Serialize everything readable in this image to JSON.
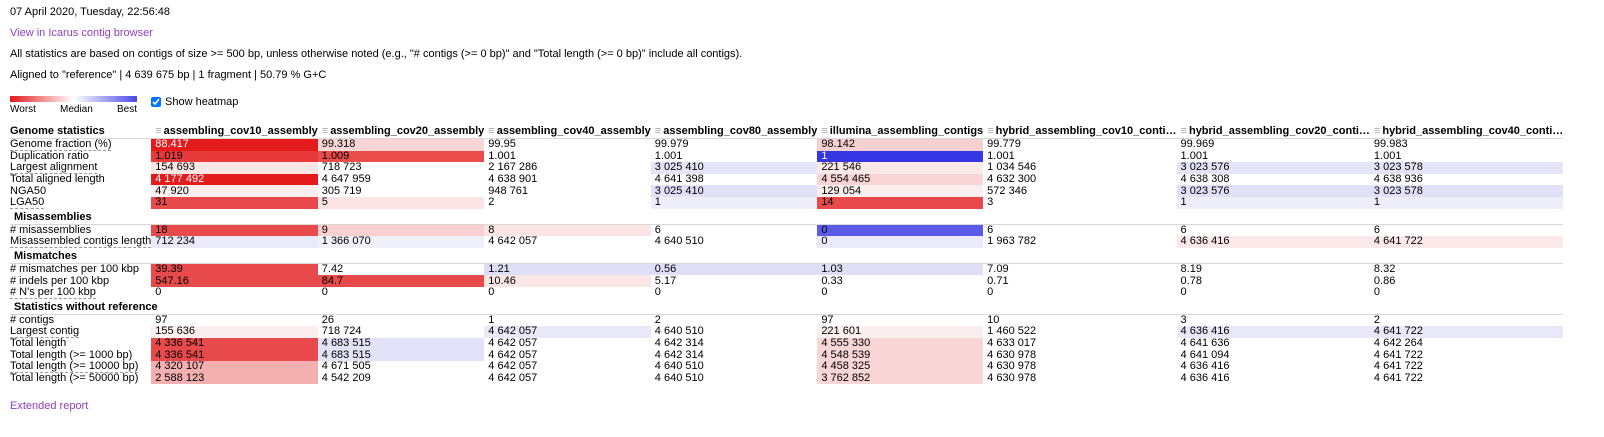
{
  "date": "07 April 2020, Tuesday, 22:56:48",
  "icarus_link": "View in Icarus contig browser",
  "note": "All statistics are based on contigs of size >= 500 bp, unless otherwise noted (e.g., \"# contigs (>= 0 bp)\" and \"Total length (>= 0 bp)\" include all contigs).",
  "reference": "Aligned to \"reference\" | 4 639 675 bp | 1 fragment | 50.79 % G+C",
  "heatmap": {
    "worst": "Worst",
    "median": "Median",
    "best": "Best",
    "show_label": "Show heatmap",
    "checked": true
  },
  "colors": {
    "worst": "#e41a1c",
    "best": "#4a4ae8",
    "link": "#9040c0"
  },
  "columns": [
    "assembling_cov10_assembly",
    "assembling_cov20_assembly",
    "assembling_cov40_assembly",
    "assembling_cov80_assembly",
    "illumina_assembling_contigs",
    "hybrid_assembling_cov10_conti…",
    "hybrid_assembling_cov20_conti…",
    "hybrid_assembling_cov40_conti…"
  ],
  "table": [
    {
      "title": "Genome statistics",
      "header": true,
      "rows": [
        {
          "name": "Genome fraction (%)",
          "cells": [
            {
              "v": "88.417",
              "bg": "#e31b1c",
              "fg": "#ffffff"
            },
            {
              "v": "99.318",
              "bg": "#f8d6d6"
            },
            {
              "v": "99.95",
              "bg": ""
            },
            {
              "v": "99.979",
              "bg": ""
            },
            {
              "v": "98.142",
              "bg": "#f6d0d0"
            },
            {
              "v": "99.779",
              "bg": ""
            },
            {
              "v": "99.969",
              "bg": ""
            },
            {
              "v": "99.983",
              "bg": ""
            }
          ]
        },
        {
          "name": "Duplication ratio",
          "cells": [
            {
              "v": "1.019",
              "bg": "#e8393a"
            },
            {
              "v": "1.009",
              "bg": "#eb4c4c"
            },
            {
              "v": "1.001",
              "bg": ""
            },
            {
              "v": "1.001",
              "bg": ""
            },
            {
              "v": "1",
              "bg": "#3636e4",
              "fg": "#ffffff"
            },
            {
              "v": "1.001",
              "bg": ""
            },
            {
              "v": "1.001",
              "bg": ""
            },
            {
              "v": "1.001",
              "bg": ""
            }
          ]
        },
        {
          "name": "Largest alignment",
          "cells": [
            {
              "v": "154 693",
              "bg": "#fbe6e6"
            },
            {
              "v": "718 723",
              "bg": ""
            },
            {
              "v": "2 167 286",
              "bg": ""
            },
            {
              "v": "3 025 410",
              "bg": "#e4e4f8"
            },
            {
              "v": "221 546",
              "bg": "#fbe8e8"
            },
            {
              "v": "1 034 546",
              "bg": ""
            },
            {
              "v": "3 023 576",
              "bg": "#e4e4f8"
            },
            {
              "v": "3 023 578",
              "bg": "#e4e4f8"
            }
          ]
        },
        {
          "name": "Total aligned length",
          "cells": [
            {
              "v": "4 177 492",
              "bg": "#e31b1c",
              "fg": "#ffffff"
            },
            {
              "v": "4 647 959",
              "bg": ""
            },
            {
              "v": "4 638 901",
              "bg": ""
            },
            {
              "v": "4 641 398",
              "bg": ""
            },
            {
              "v": "4 554 465",
              "bg": "#f8d4d4"
            },
            {
              "v": "4 632 300",
              "bg": ""
            },
            {
              "v": "4 638 308",
              "bg": ""
            },
            {
              "v": "4 638 936",
              "bg": ""
            }
          ]
        },
        {
          "name": "NGA50",
          "cells": [
            {
              "v": "47 920",
              "bg": "#fbeeee"
            },
            {
              "v": "305 719",
              "bg": ""
            },
            {
              "v": "948 761",
              "bg": ""
            },
            {
              "v": "3 025 410",
              "bg": "#e0e0f7"
            },
            {
              "v": "129 054",
              "bg": "#fbeeee"
            },
            {
              "v": "572 346",
              "bg": ""
            },
            {
              "v": "3 023 576",
              "bg": "#e0e0f7"
            },
            {
              "v": "3 023 578",
              "bg": "#e0e0f7"
            }
          ]
        },
        {
          "name": "LGA50",
          "cells": [
            {
              "v": "31",
              "bg": "#e84a4b"
            },
            {
              "v": "5",
              "bg": "#fae4e4"
            },
            {
              "v": "2",
              "bg": ""
            },
            {
              "v": "1",
              "bg": "#eeeefa"
            },
            {
              "v": "14",
              "bg": "#e84a4b"
            },
            {
              "v": "3",
              "bg": ""
            },
            {
              "v": "1",
              "bg": "#eeeefa"
            },
            {
              "v": "1",
              "bg": "#eeeefa"
            }
          ]
        }
      ]
    },
    {
      "title": "Misassemblies",
      "rows": [
        {
          "name": "# misassemblies",
          "cells": [
            {
              "v": "18",
              "bg": "#e84a4b"
            },
            {
              "v": "9",
              "bg": "#f8d0d0"
            },
            {
              "v": "8",
              "bg": "#fbe4e4"
            },
            {
              "v": "6",
              "bg": ""
            },
            {
              "v": "0",
              "bg": "#5a5ae6"
            },
            {
              "v": "6",
              "bg": ""
            },
            {
              "v": "6",
              "bg": ""
            },
            {
              "v": "6",
              "bg": ""
            }
          ]
        },
        {
          "name": "Misassembled contigs length",
          "cells": [
            {
              "v": "712 234",
              "bg": "#eaeafa"
            },
            {
              "v": "1 366 070",
              "bg": "#f0f0fb"
            },
            {
              "v": "4 642 057",
              "bg": ""
            },
            {
              "v": "4 640 510",
              "bg": ""
            },
            {
              "v": "0",
              "bg": "#eaeafa"
            },
            {
              "v": "1 963 782",
              "bg": ""
            },
            {
              "v": "4 636 416",
              "bg": "#fbe9e9"
            },
            {
              "v": "4 641 722",
              "bg": "#fbe9e9"
            }
          ]
        }
      ]
    },
    {
      "title": "Mismatches",
      "rows": [
        {
          "name": "# mismatches per 100 kbp",
          "cells": [
            {
              "v": "39.39",
              "bg": "#e84a4b"
            },
            {
              "v": "7.42",
              "bg": ""
            },
            {
              "v": "1.21",
              "bg": "#dedef6"
            },
            {
              "v": "0.56",
              "bg": "#dedef6"
            },
            {
              "v": "1.03",
              "bg": "#dedef6"
            },
            {
              "v": "7.09",
              "bg": ""
            },
            {
              "v": "8.19",
              "bg": ""
            },
            {
              "v": "8.32",
              "bg": ""
            }
          ]
        },
        {
          "name": "# indels per 100 kbp",
          "cells": [
            {
              "v": "547.16",
              "bg": "#e84a4b"
            },
            {
              "v": "84.7",
              "bg": "#e84a4b"
            },
            {
              "v": "10.46",
              "bg": "#fbe6e6"
            },
            {
              "v": "5.17",
              "bg": ""
            },
            {
              "v": "0.33",
              "bg": ""
            },
            {
              "v": "0.71",
              "bg": ""
            },
            {
              "v": "0.78",
              "bg": ""
            },
            {
              "v": "0.86",
              "bg": ""
            }
          ]
        },
        {
          "name": "# N's per 100 kbp",
          "cells": [
            {
              "v": "0",
              "bg": ""
            },
            {
              "v": "0",
              "bg": ""
            },
            {
              "v": "0",
              "bg": ""
            },
            {
              "v": "0",
              "bg": ""
            },
            {
              "v": "0",
              "bg": ""
            },
            {
              "v": "0",
              "bg": ""
            },
            {
              "v": "0",
              "bg": ""
            },
            {
              "v": "0",
              "bg": ""
            }
          ]
        }
      ]
    },
    {
      "title": "Statistics without reference",
      "rows": [
        {
          "name": "# contigs",
          "cells": [
            {
              "v": "97",
              "bg": ""
            },
            {
              "v": "26",
              "bg": ""
            },
            {
              "v": "1",
              "bg": ""
            },
            {
              "v": "2",
              "bg": ""
            },
            {
              "v": "97",
              "bg": ""
            },
            {
              "v": "10",
              "bg": ""
            },
            {
              "v": "3",
              "bg": ""
            },
            {
              "v": "2",
              "bg": ""
            }
          ]
        },
        {
          "name": "Largest contig",
          "cells": [
            {
              "v": "155 636",
              "bg": "#fbeeee"
            },
            {
              "v": "718 724",
              "bg": ""
            },
            {
              "v": "4 642 057",
              "bg": "#e8e8f9"
            },
            {
              "v": "4 640 510",
              "bg": ""
            },
            {
              "v": "221 601",
              "bg": "#fbeeee"
            },
            {
              "v": "1 460 522",
              "bg": ""
            },
            {
              "v": "4 636 416",
              "bg": "#e8e8f9"
            },
            {
              "v": "4 641 722",
              "bg": "#e8e8f9"
            }
          ]
        },
        {
          "name": "Total length",
          "cells": [
            {
              "v": "4 336 541",
              "bg": "#e84a4b"
            },
            {
              "v": "4 683 515",
              "bg": "#e2e2f8"
            },
            {
              "v": "4 642 057",
              "bg": ""
            },
            {
              "v": "4 642 314",
              "bg": ""
            },
            {
              "v": "4 555 330",
              "bg": "#f8d6d6"
            },
            {
              "v": "4 633 017",
              "bg": ""
            },
            {
              "v": "4 641 636",
              "bg": ""
            },
            {
              "v": "4 642 264",
              "bg": ""
            }
          ]
        },
        {
          "name": "Total length (>= 1000 bp)",
          "cells": [
            {
              "v": "4 336 541",
              "bg": "#e84a4b"
            },
            {
              "v": "4 683 515",
              "bg": "#e2e2f8"
            },
            {
              "v": "4 642 057",
              "bg": ""
            },
            {
              "v": "4 642 314",
              "bg": ""
            },
            {
              "v": "4 548 539",
              "bg": "#f8d6d6"
            },
            {
              "v": "4 630 978",
              "bg": ""
            },
            {
              "v": "4 641 094",
              "bg": ""
            },
            {
              "v": "4 641 722",
              "bg": ""
            }
          ]
        },
        {
          "name": "Total length (>= 10000 bp)",
          "cells": [
            {
              "v": "4 320 107",
              "bg": "#f4b0b0"
            },
            {
              "v": "4 671 505",
              "bg": ""
            },
            {
              "v": "4 642 057",
              "bg": ""
            },
            {
              "v": "4 640 510",
              "bg": ""
            },
            {
              "v": "4 458 325",
              "bg": "#f8d6d6"
            },
            {
              "v": "4 630 978",
              "bg": ""
            },
            {
              "v": "4 636 416",
              "bg": ""
            },
            {
              "v": "4 641 722",
              "bg": ""
            }
          ]
        },
        {
          "name": "Total length (>= 50000 bp)",
          "cells": [
            {
              "v": "2 588 123",
              "bg": "#f4b0b0"
            },
            {
              "v": "4 542 209",
              "bg": ""
            },
            {
              "v": "4 642 057",
              "bg": ""
            },
            {
              "v": "4 640 510",
              "bg": ""
            },
            {
              "v": "3 762 852",
              "bg": "#f8d6d6"
            },
            {
              "v": "4 630 978",
              "bg": ""
            },
            {
              "v": "4 636 416",
              "bg": ""
            },
            {
              "v": "4 641 722",
              "bg": ""
            }
          ]
        }
      ]
    }
  ],
  "extended_link": "Extended report"
}
